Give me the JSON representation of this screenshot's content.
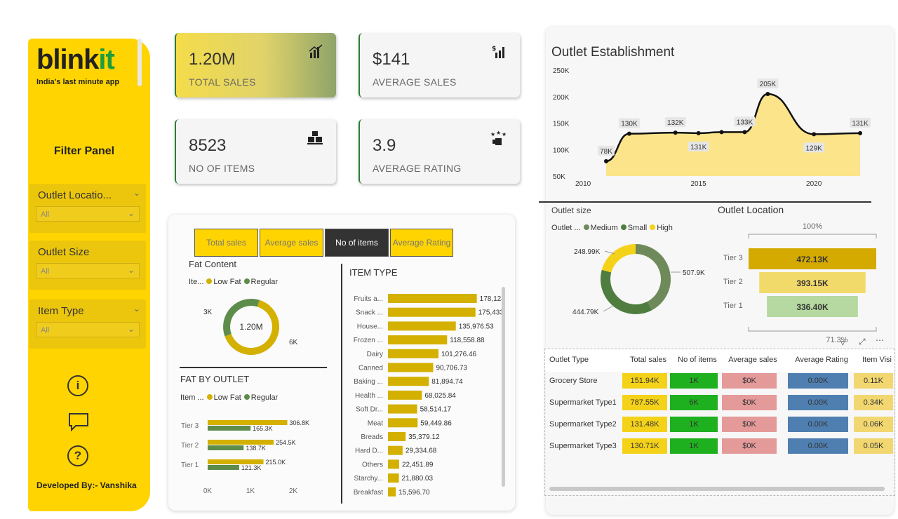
{
  "colors": {
    "brand_yellow": "#ffd400",
    "green": "#1f9d3a",
    "bar_gold": "#d4b000",
    "bar_green": "#5e8c4a",
    "area_fill": "#fbe48a"
  },
  "sidebar": {
    "logo_main": "blink",
    "logo_accent": "it",
    "tagline": "India's last minute app",
    "filter_title": "Filter Panel",
    "slicers": [
      {
        "label": "Outlet Locatio...",
        "value": "All"
      },
      {
        "label": "Outlet Size",
        "value": "All"
      },
      {
        "label": "Item Type",
        "value": "All"
      }
    ],
    "icons": [
      "info-icon",
      "comment-icon",
      "help-icon"
    ],
    "developer": "Developed By:- Vanshika"
  },
  "kpis": [
    {
      "value": "1.20M",
      "label": "TOTAL SALES",
      "icon": "bar-chart-icon"
    },
    {
      "value": "$141",
      "label": "AVERAGE SALES",
      "icon": "dollar-chart-icon"
    },
    {
      "value": "8523",
      "label": "NO OF ITEMS",
      "icon": "boxes-icon"
    },
    {
      "value": "3.9",
      "label": "AVERAGE RATING",
      "icon": "stars-icon"
    }
  ],
  "tabs": [
    {
      "label": "Total sales",
      "active": false
    },
    {
      "label": "Average sales",
      "active": false
    },
    {
      "label": "No of items",
      "active": true
    },
    {
      "label": "Average Rating",
      "active": false
    }
  ],
  "fat_content": {
    "title": "Fat Content",
    "legend_prefix": "Ite...",
    "legend": [
      "Low Fat",
      "Regular"
    ],
    "center": "1.20M",
    "label_small": "3K",
    "label_large": "6K"
  },
  "fat_by_outlet": {
    "title": "FAT BY OUTLET",
    "legend_prefix": "Item ...",
    "legend": [
      "Low Fat",
      "Regular"
    ]
  },
  "item_type": {
    "title": "ITEM TYPE"
  },
  "outlet_establishment": {
    "title": "Outlet Establishment"
  },
  "outlet_size": {
    "title": "Outlet size",
    "legend_prefix": "Outlet ...",
    "legend": [
      "Medium",
      "Small",
      "High"
    ]
  },
  "outlet_location": {
    "title": "Outlet Location",
    "top_pct": "100%",
    "bottom_pct": "71.3%"
  },
  "outlet_table": {
    "headers": [
      "Outlet Type",
      "Total sales",
      "No of items",
      "Average sales",
      "Average Rating",
      "Item Visi"
    ],
    "rows": [
      [
        "Grocery Store",
        "151.94K",
        "1K",
        "$0K",
        "0.00K",
        "0.11K"
      ],
      [
        "Supermarket Type1",
        "787.55K",
        "6K",
        "$0K",
        "0.00K",
        "0.34K"
      ],
      [
        "Supermarket Type2",
        "131.48K",
        "1K",
        "$0K",
        "0.00K",
        "0.06K"
      ],
      [
        "Supermarket Type3",
        "130.71K",
        "1K",
        "$0K",
        "0.00K",
        "0.05K"
      ]
    ]
  },
  "chart_data": [
    {
      "type": "pie",
      "title": "Fat Content",
      "categories": [
        "Low Fat",
        "Regular"
      ],
      "values": [
        5517,
        3006
      ]
    },
    {
      "type": "bar",
      "title": "FAT BY OUTLET",
      "orientation": "horizontal",
      "categories": [
        "Tier 3",
        "Tier 2",
        "Tier 1"
      ],
      "series": [
        {
          "name": "Low Fat",
          "values": [
            306.8,
            254.5,
            215.0
          ],
          "labels": [
            "306.8K",
            "254.5K",
            "215.0K"
          ]
        },
        {
          "name": "Regular",
          "values": [
            165.3,
            138.7,
            121.3
          ],
          "labels": [
            "165.3K",
            "138.7K",
            "121.3K"
          ]
        }
      ],
      "xticks": [
        "0K",
        "1K",
        "2K"
      ]
    },
    {
      "type": "bar",
      "title": "ITEM TYPE",
      "orientation": "horizontal",
      "categories": [
        "Fruits a...",
        "Snack ...",
        "House...",
        "Frozen ...",
        "Dairy",
        "Canned",
        "Baking ...",
        "Health ...",
        "Soft Dr...",
        "Meat",
        "Breads",
        "Hard D...",
        "Others",
        "Starchy...",
        "Breakfast"
      ],
      "values": [
        178124.08,
        175433.92,
        135976.53,
        118558.88,
        101276.46,
        90706.73,
        81894.74,
        68025.84,
        58514.17,
        59449.86,
        35379.12,
        29334.68,
        22451.89,
        21880.03,
        15596.7
      ],
      "labels": [
        "178,124.08",
        "175,433.92",
        "135,976.53",
        "118,558.88",
        "101,276.46",
        "90,706.73",
        "81,894.74",
        "68,025.84",
        "58,514.17",
        "59,449.86",
        "35,379.12",
        "29,334.68",
        "22,451.89",
        "21,880.03",
        "15,596.70"
      ]
    },
    {
      "type": "area",
      "title": "Outlet Establishment",
      "x": [
        2011,
        2012,
        2014,
        2015,
        2016,
        2017,
        2018,
        2020,
        2022
      ],
      "values": [
        78,
        130,
        132,
        131,
        133,
        133,
        205,
        129,
        131
      ],
      "labels": [
        "78K",
        "130K",
        "132K",
        "131K",
        "",
        "133K",
        "205K",
        "129K",
        "131K"
      ],
      "yticks": [
        "250K",
        "200K",
        "150K",
        "100K",
        "50K"
      ],
      "xticks": [
        "2010",
        "2015",
        "2020"
      ],
      "ylim": [
        50,
        250
      ]
    },
    {
      "type": "pie",
      "title": "Outlet size",
      "categories": [
        "Medium",
        "Small",
        "High"
      ],
      "values": [
        507.9,
        444.79,
        248.99
      ],
      "labels": [
        "507.9K",
        "444.79K",
        "248.99K"
      ]
    },
    {
      "type": "bar",
      "title": "Outlet Location",
      "categories": [
        "Tier 3",
        "Tier 2",
        "Tier 1"
      ],
      "values": [
        472.13,
        393.15,
        336.4
      ],
      "labels": [
        "472.13K",
        "393.15K",
        "336.40K"
      ]
    }
  ]
}
